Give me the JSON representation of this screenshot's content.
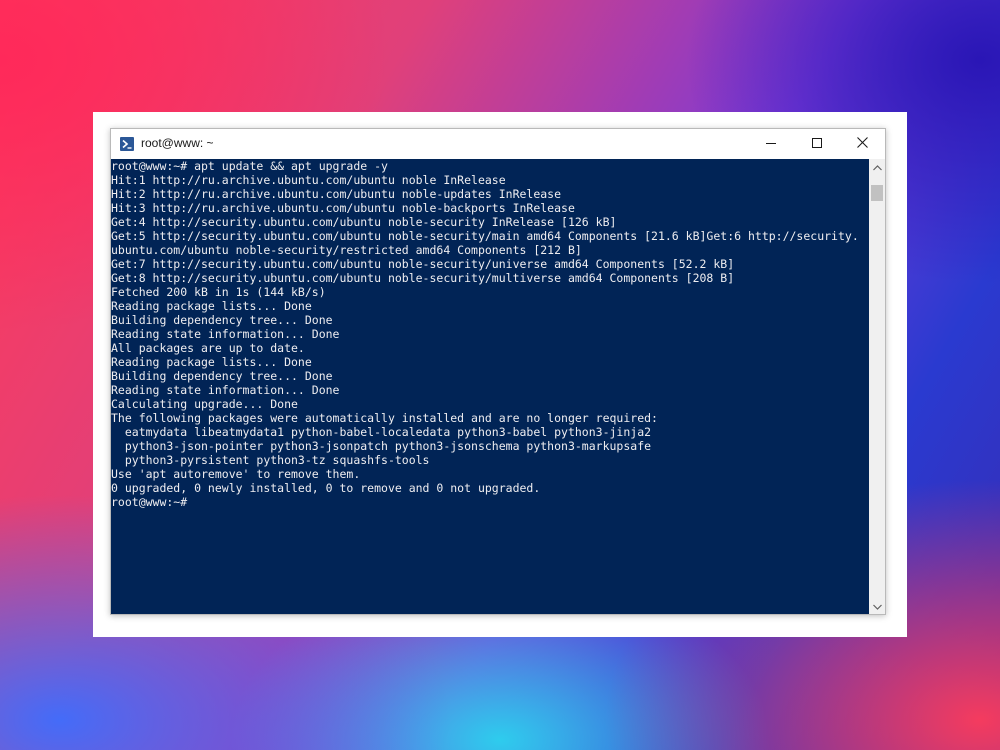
{
  "window": {
    "title": "root@www: ~",
    "icon": "terminal-icon",
    "controls": [
      "minimize-icon",
      "maximize-icon",
      "close-icon"
    ]
  },
  "terminal": {
    "background": "#012456",
    "foreground": "#eeedf0",
    "lines": [
      "root@www:~# apt update && apt upgrade -y",
      "Hit:1 http://ru.archive.ubuntu.com/ubuntu noble InRelease",
      "Hit:2 http://ru.archive.ubuntu.com/ubuntu noble-updates InRelease",
      "Hit:3 http://ru.archive.ubuntu.com/ubuntu noble-backports InRelease",
      "Get:4 http://security.ubuntu.com/ubuntu noble-security InRelease [126 kB]",
      "Get:5 http://security.ubuntu.com/ubuntu noble-security/main amd64 Components [21.6 kB]Get:6 http://security.",
      "ubuntu.com/ubuntu noble-security/restricted amd64 Components [212 B]",
      "Get:7 http://security.ubuntu.com/ubuntu noble-security/universe amd64 Components [52.2 kB]",
      "Get:8 http://security.ubuntu.com/ubuntu noble-security/multiverse amd64 Components [208 B]",
      "Fetched 200 kB in 1s (144 kB/s)",
      "Reading package lists... Done",
      "Building dependency tree... Done",
      "Reading state information... Done",
      "All packages are up to date.",
      "Reading package lists... Done",
      "Building dependency tree... Done",
      "Reading state information... Done",
      "Calculating upgrade... Done",
      "The following packages were automatically installed and are no longer required:",
      "  eatmydata libeatmydata1 python-babel-localedata python3-babel python3-jinja2",
      "  python3-json-pointer python3-jsonpatch python3-jsonschema python3-markupsafe",
      "  python3-pyrsistent python3-tz squashfs-tools",
      "Use 'apt autoremove' to remove them.",
      "0 upgraded, 0 newly installed, 0 to remove and 0 not upgraded.",
      "root@www:~#"
    ]
  },
  "scrollbar": {
    "up_icon": "chevron-up-icon",
    "down_icon": "chevron-down-icon"
  }
}
